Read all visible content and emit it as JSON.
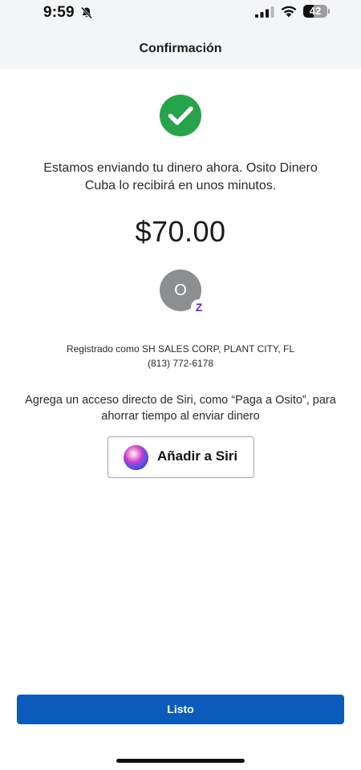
{
  "status_bar": {
    "time": "9:59",
    "battery_level": "42",
    "battery_fraction": 0.42,
    "icons": [
      "bell-slash-icon",
      "cellular-signal-icon",
      "wifi-icon",
      "battery-icon"
    ]
  },
  "header": {
    "title": "Confirmación"
  },
  "confirmation": {
    "icon": "checkmark-circle-icon",
    "message": "Estamos enviando tu dinero ahora. Osito Dinero Cuba lo recibirá en unos minutos.",
    "amount": "$70.00"
  },
  "recipient": {
    "avatar_initial": "O",
    "badge_glyph": "Z",
    "registered_line": "Registrado como SH SALES CORP, PLANT CITY, FL",
    "phone": "(813) 772-6178"
  },
  "siri": {
    "hint": "Agrega un acceso directo de Siri, como “Paga a Osito”, para ahorrar tiempo al enviar dinero",
    "button_label": "Añadir a Siri",
    "icon": "siri-icon"
  },
  "footer": {
    "done_label": "Listo"
  },
  "colors": {
    "success": "#27a34a",
    "primary": "#0b5bbd",
    "avatar": "#8d8e90",
    "zelle": "#6d1ed4"
  }
}
